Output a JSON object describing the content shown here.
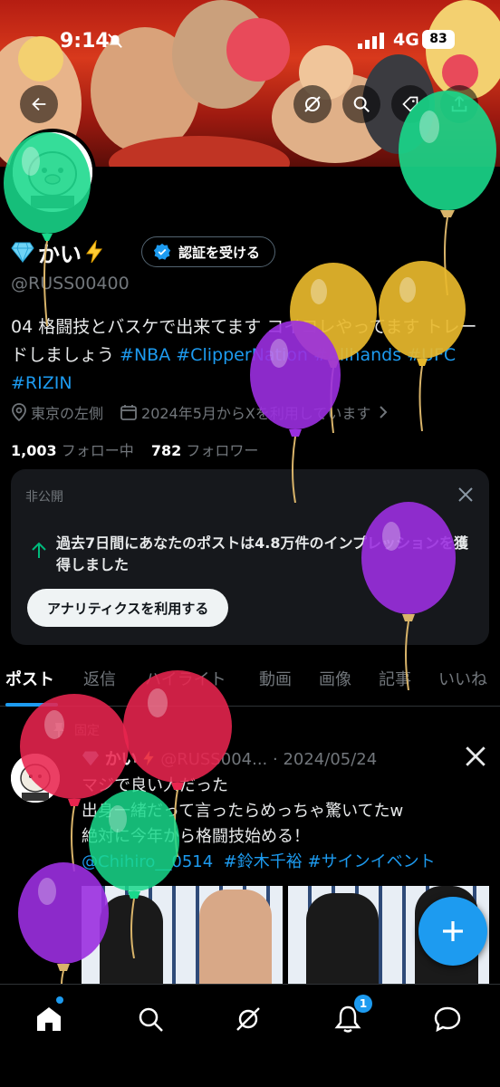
{
  "status": {
    "time": "9:14",
    "network": "4G",
    "battery": "83"
  },
  "profile": {
    "display_name": "かい",
    "verify_label": "認証を受ける",
    "handle": "@RUSS00400",
    "bio_text": "04 格闘技とバスケで出来てます コイコレやってます トレードしましょう ",
    "bio_tags": [
      "#NBA",
      "#ClipperNation",
      "#Allhands",
      "#UFC",
      "#RIZIN"
    ],
    "location": "東京の左側",
    "joined": "2024年5月からXを利用しています",
    "following_count": "1,003",
    "following_label": "フォロー中",
    "followers_count": "782",
    "followers_label": "フォロワー"
  },
  "card": {
    "label": "非公開",
    "text": "過去7日間にあなたのポストは4.8万件のインプレッションを獲得しました",
    "button": "アナリティクスを利用する"
  },
  "tabs": [
    "ポスト",
    "返信",
    "ハイライト",
    "動画",
    "画像",
    "記事",
    "いいね"
  ],
  "post": {
    "pinned_label": "固定",
    "author": "かい",
    "handle": "@RUSS004...",
    "date": "· 2024/05/24",
    "line1": "マジで良い人だった",
    "line2": "出身一緒だって言ったらめっちゃ驚いてたw",
    "line3": "絶対に今年から格闘技始める！",
    "mention": "@Chihiro__0514",
    "tag1": "#鈴木千裕",
    "tag2": "#サインイベント"
  },
  "nav": {
    "notifications_badge": "1"
  },
  "colors": {
    "accent": "#1d9bf0",
    "background": "#000000",
    "card": "#16181c",
    "muted": "#71767b"
  }
}
